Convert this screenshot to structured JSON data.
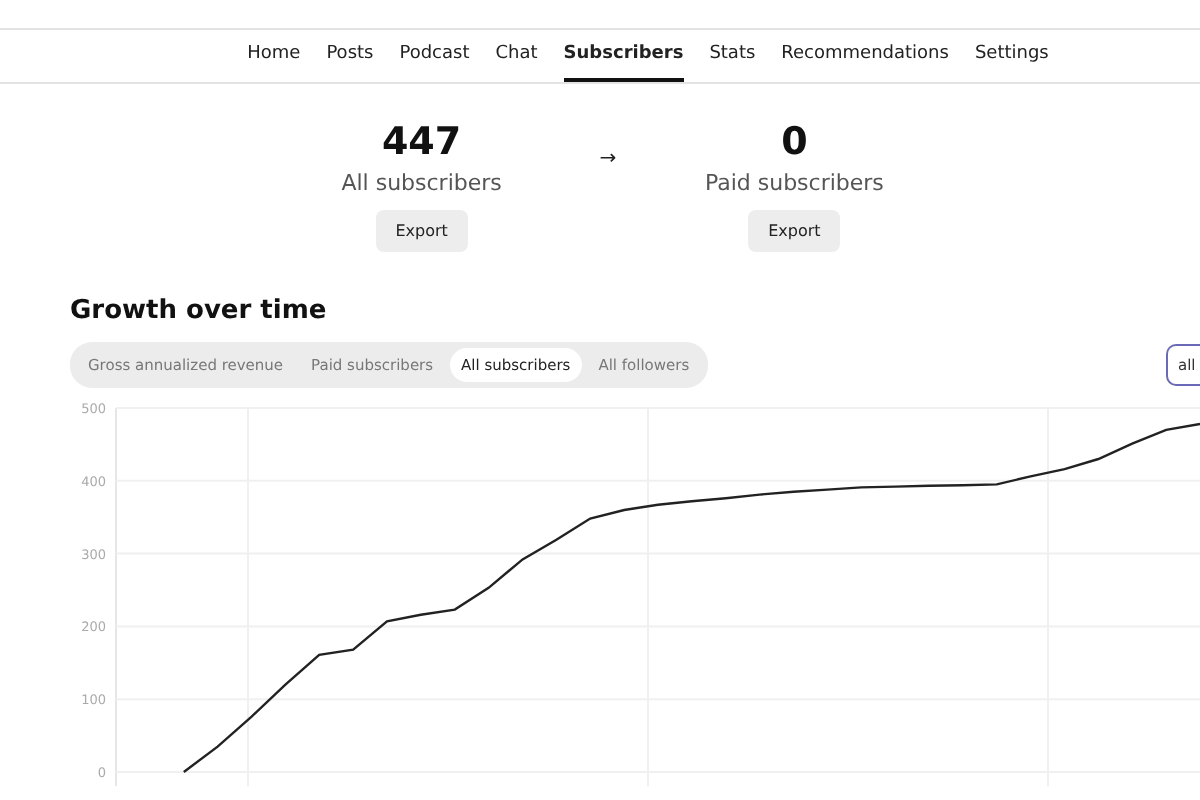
{
  "nav": {
    "tabs": [
      {
        "label": "Home",
        "selected": false
      },
      {
        "label": "Posts",
        "selected": false
      },
      {
        "label": "Podcast",
        "selected": false
      },
      {
        "label": "Chat",
        "selected": false
      },
      {
        "label": "Subscribers",
        "selected": true
      },
      {
        "label": "Stats",
        "selected": false
      },
      {
        "label": "Recommendations",
        "selected": false
      },
      {
        "label": "Settings",
        "selected": false
      }
    ]
  },
  "summary": {
    "arrow": "→",
    "stats": [
      {
        "value": "447",
        "label": "All subscribers",
        "button": "Export"
      },
      {
        "value": "0",
        "label": "Paid subscribers",
        "button": "Export"
      }
    ]
  },
  "growth": {
    "title": "Growth over time",
    "filters": [
      {
        "label": "Gross annualized revenue",
        "selected": false
      },
      {
        "label": "Paid subscribers",
        "selected": false
      },
      {
        "label": "All subscribers",
        "selected": true
      },
      {
        "label": "All followers",
        "selected": false
      }
    ],
    "range_select": "all",
    "chart_data": {
      "type": "line",
      "grid": true,
      "ylim": [
        0,
        500
      ],
      "yticks": [
        0,
        100,
        200,
        300,
        400,
        500
      ],
      "categories": [
        null,
        null,
        null,
        null,
        null,
        null,
        null,
        null,
        null,
        null,
        null,
        null,
        null,
        null,
        null,
        null,
        null,
        null,
        null,
        null,
        null,
        null,
        null,
        null,
        null,
        null,
        null,
        null,
        null,
        null,
        null,
        null,
        null
      ],
      "values": [
        null,
        null,
        0,
        35,
        76,
        120,
        161,
        168,
        207,
        216,
        223,
        253,
        292,
        319,
        348,
        360,
        367,
        372,
        376,
        381,
        385,
        388,
        391,
        392,
        393,
        394,
        395,
        406,
        416,
        430,
        451,
        470,
        478
      ]
    }
  }
}
